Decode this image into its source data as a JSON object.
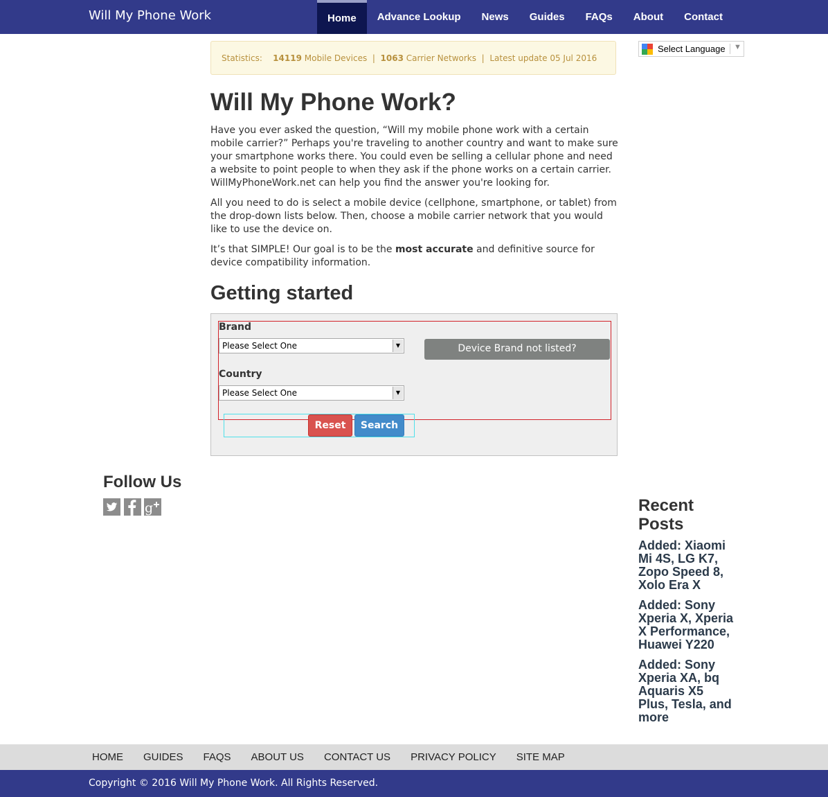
{
  "header": {
    "brand": "Will My Phone Work",
    "nav": [
      {
        "label": "Home",
        "active": true
      },
      {
        "label": "Advance Lookup"
      },
      {
        "label": "News"
      },
      {
        "label": "Guides"
      },
      {
        "label": "FAQs"
      },
      {
        "label": "About"
      },
      {
        "label": "Contact"
      }
    ]
  },
  "stats": {
    "prefix": "Statistics:",
    "devices_count": "14119",
    "devices_label": "Mobile Devices",
    "sep": "|",
    "carriers_count": "1063",
    "carriers_label": "Carrier Networks",
    "update": "Latest update 05 Jul 2016"
  },
  "language": {
    "label": "Select Language",
    "arrow": "▼"
  },
  "main": {
    "title": "Will My Phone Work?",
    "para1": "Have you ever asked the question, “Will my mobile phone work with a certain mobile carrier?” Perhaps you're traveling to another country and want to make sure your smartphone works there. You could even be selling a cellular phone and need a website to point people to when they ask if the phone works on a certain carrier. WillMyPhoneWork.net can help you find the answer you're looking for.",
    "para2": "All you need to do is select a mobile device (cellphone, smartphone, or tablet) from the drop-down lists below. Then, choose a mobile carrier network that you would like to use the device on.",
    "para3_before": "It’s that SIMPLE! Our goal is to be the ",
    "para3_bold": "most accurate",
    "para3_after": " and definitive source for device compatibility information.",
    "section_title": "Getting started"
  },
  "form": {
    "brand_label": "Brand",
    "brand_value": "Please Select One",
    "country_label": "Country",
    "country_value": "Please Select One",
    "not_listed_button": "Device Brand not listed?",
    "reset_button": "Reset",
    "search_button": "Search",
    "dropdown_glyph": "▼"
  },
  "follow": {
    "title": "Follow Us",
    "icons": [
      "twitter-icon",
      "facebook-icon",
      "google-plus-icon"
    ]
  },
  "recent": {
    "title": "Recent Posts",
    "posts": [
      "Added: Xiaomi Mi 4S, LG K7, Zopo Speed 8, Xolo Era X",
      "Added: Sony Xperia X, Xperia X Performance, Huawei Y220",
      "Added: Sony Xperia XA, bq Aquaris X5 Plus, Tesla, and more"
    ]
  },
  "footer": {
    "links": [
      "HOME",
      "GUIDES",
      "FAQS",
      "ABOUT US",
      "CONTACT US",
      "PRIVACY POLICY",
      "SITE MAP"
    ],
    "copyright": "Copyright © 2016 Will My Phone Work. All Rights Reserved."
  },
  "colors": {
    "header_bg": "#323a8a",
    "nav_active_bg": "#0e1650",
    "stats_bg": "#fcf8e3",
    "stats_text": "#b8913e",
    "reset_button": "#d9534f",
    "search_button": "#428bca",
    "not_listed_button": "#7f8280",
    "footer_nav_bg": "#dcdcdc"
  }
}
